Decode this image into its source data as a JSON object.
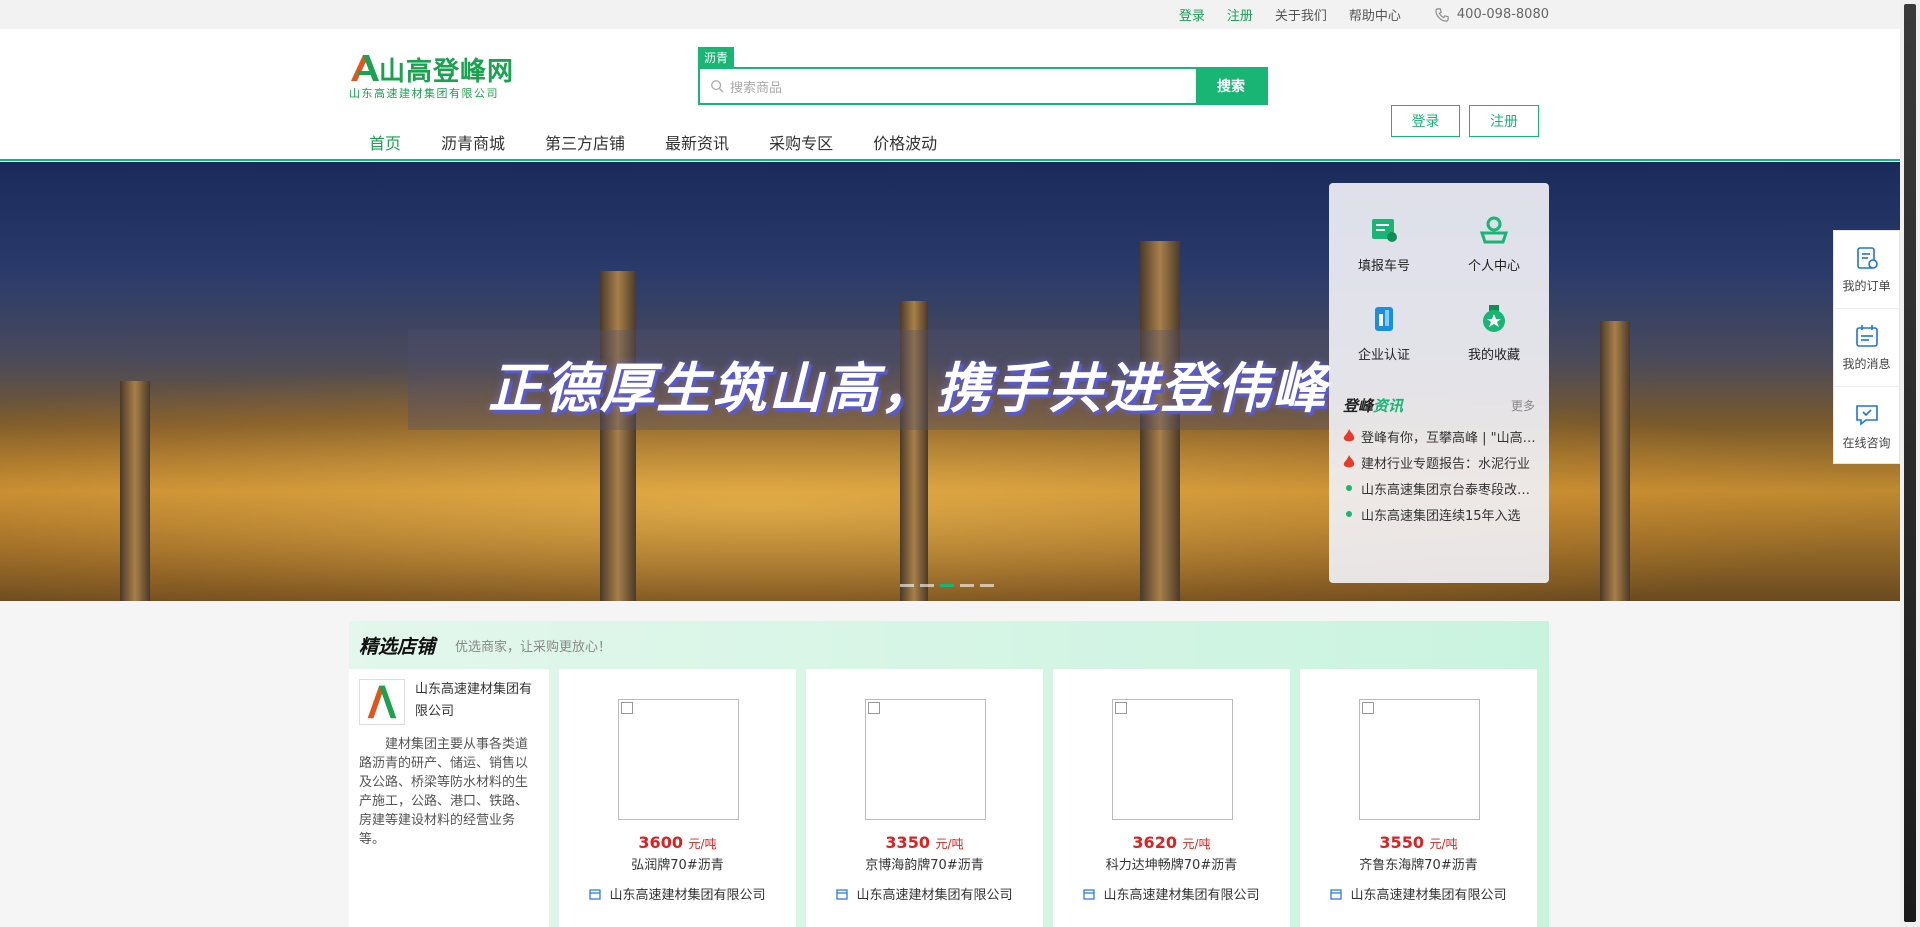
{
  "topbar": {
    "login": "登录",
    "register": "注册",
    "about": "关于我们",
    "help": "帮助中心",
    "phone": "400-098-8080"
  },
  "logo": {
    "name": "山高登峰网",
    "subtitle": "山东高速建材集团有限公司"
  },
  "search": {
    "tag": "沥青",
    "placeholder": "搜索商品",
    "button": "搜索"
  },
  "auth": {
    "login": "登录",
    "register": "注册"
  },
  "nav": {
    "items": [
      "首页",
      "沥青商城",
      "第三方店铺",
      "最新资讯",
      "采购专区",
      "价格波动"
    ]
  },
  "banner": {
    "slogan": "正德厚生筑山高，携手共进登伟峰"
  },
  "panel": {
    "quick": [
      "填报车号",
      "个人中心",
      "企业认证",
      "我的收藏"
    ],
    "news_title_a": "登峰",
    "news_title_b": "资讯",
    "more": "更多",
    "news": [
      "登峰有你，互攀高峰 | \"山高登峰网\"",
      "建材行业专题报告：水泥行业",
      "山东高速集团京台泰枣段改扩建",
      "山东高速集团连续15年入选"
    ]
  },
  "sidebar": {
    "items": [
      "我的订单",
      "我的消息",
      "在线咨询"
    ]
  },
  "shops": {
    "title": "精选店铺",
    "subtitle": "优选商家，让采购更放心！",
    "intro_name": "山东高速建材集团有限公司",
    "intro_desc": "建材集团主要从事各类道路沥青的研产、储运、销售以及公路、桥梁等防水材料的生产施工，公路、港口、铁路、房建等建设材料的经营业务等。",
    "products": [
      {
        "price": "3600",
        "unit": "元/吨",
        "name": "弘润牌70#沥青",
        "shop": "山东高速建材集团有限公司"
      },
      {
        "price": "3350",
        "unit": "元/吨",
        "name": "京博海韵牌70#沥青",
        "shop": "山东高速建材集团有限公司"
      },
      {
        "price": "3620",
        "unit": "元/吨",
        "name": "科力达坤畅牌70#沥青",
        "shop": "山东高速建材集团有限公司"
      },
      {
        "price": "3550",
        "unit": "元/吨",
        "name": "齐鲁东海牌70#沥青",
        "shop": "山东高速建材集团有限公司"
      }
    ]
  },
  "colors": {
    "accent": "#19b574",
    "price": "#e02020"
  }
}
